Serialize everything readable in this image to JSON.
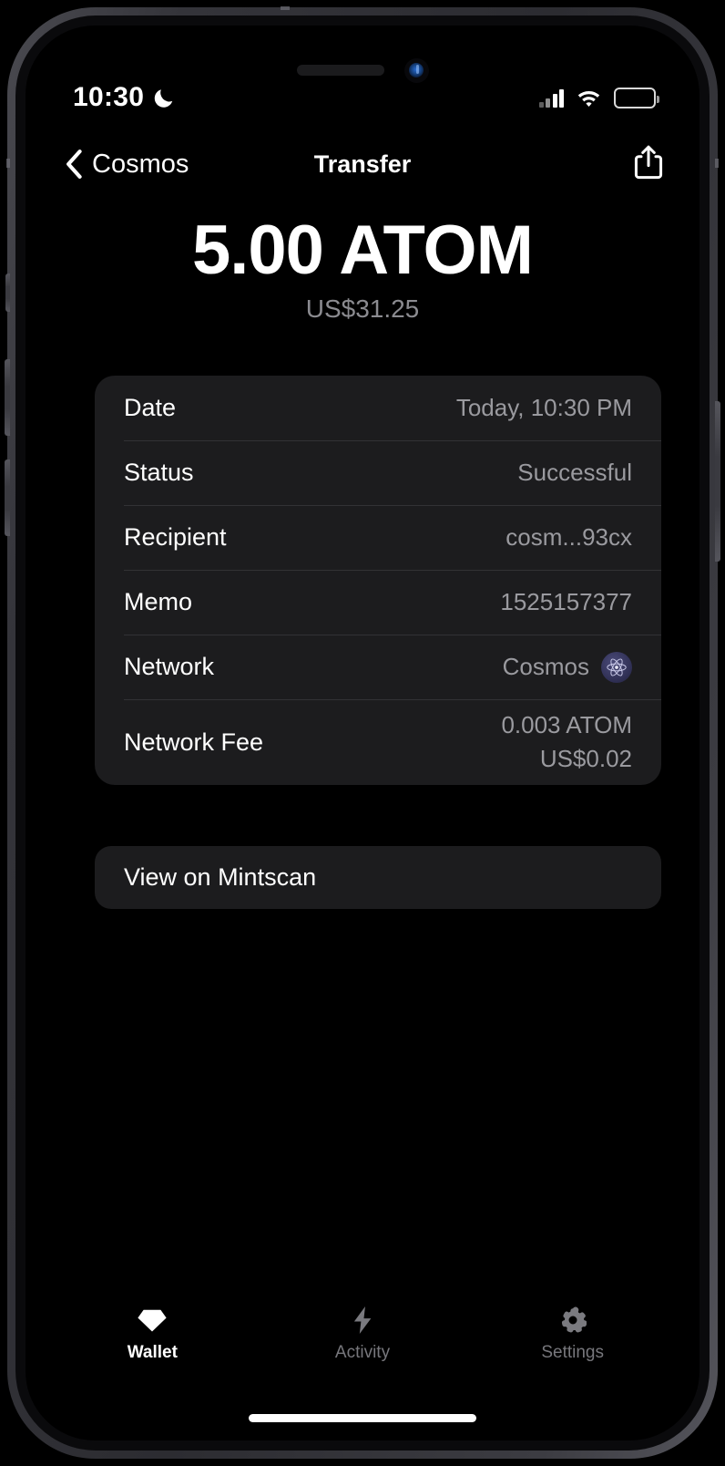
{
  "status_bar": {
    "time": "10:30",
    "moon_icon": "crescent-moon-icon",
    "cellular_icon": "cellular-bars-icon",
    "wifi_icon": "wifi-icon",
    "battery_icon": "battery-full-icon"
  },
  "nav": {
    "back_label": "Cosmos",
    "back_icon": "chevron-left-icon",
    "title": "Transfer",
    "share_icon": "share-icon"
  },
  "amount": {
    "primary": "5.00 ATOM",
    "fiat": "US$31.25"
  },
  "details": {
    "rows": [
      {
        "label": "Date",
        "value": "Today, 10:30 PM"
      },
      {
        "label": "Status",
        "value": "Successful"
      },
      {
        "label": "Recipient",
        "value": "cosm...93cx"
      },
      {
        "label": "Memo",
        "value": "1525157377"
      },
      {
        "label": "Network",
        "value": "Cosmos",
        "icon": "cosmos-atom-icon"
      },
      {
        "label": "Network Fee",
        "value": "0.003 ATOM",
        "value_secondary": "US$0.02"
      }
    ]
  },
  "link_button": {
    "label": "View on Mintscan"
  },
  "tab_bar": {
    "items": [
      {
        "label": "Wallet",
        "icon": "diamond-icon",
        "active": true
      },
      {
        "label": "Activity",
        "icon": "bolt-icon",
        "active": false
      },
      {
        "label": "Settings",
        "icon": "gear-icon",
        "active": false
      }
    ]
  },
  "colors": {
    "background": "#000000",
    "card": "#1c1c1e",
    "divider": "#323235",
    "secondary_text": "#9a9a9f",
    "accent_network": "#2e2e52"
  }
}
